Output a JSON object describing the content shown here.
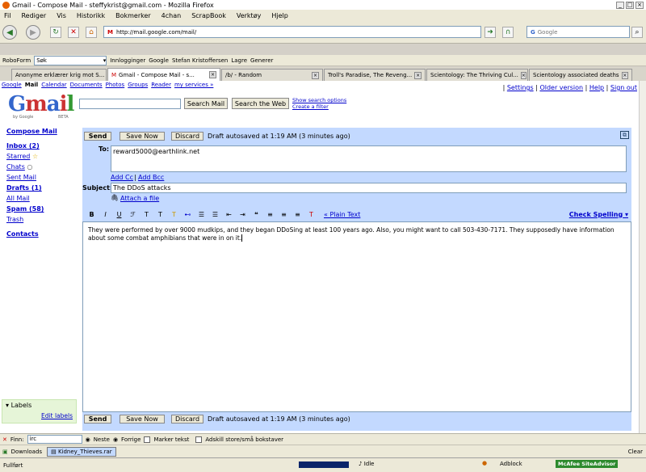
{
  "window": {
    "title": "Gmail - Compose Mail - steffykrist@gmail.com - Mozilla Firefox"
  },
  "menu": [
    "Fil",
    "Rediger",
    "Vis",
    "Historikk",
    "Bokmerker",
    "4chan",
    "ScrapBook",
    "Verktøy",
    "Hjelp"
  ],
  "address": {
    "url": "http://mail.google.com/mail/",
    "search_placeholder": "Google"
  },
  "bookmarks": {
    "roboform": "RoboForm",
    "search_value": "Søk",
    "items": [
      "Innlogginger",
      "Google",
      "Stefan Kristoffersen",
      "Lagre",
      "Generer"
    ]
  },
  "tabs": [
    {
      "label": "Anonyme erklærer krig mot S..."
    },
    {
      "label": "Gmail - Compose Mail - s..."
    },
    {
      "label": "/b/ - Random"
    },
    {
      "label": "Troll's Paradise, The Reveng..."
    },
    {
      "label": "Scientology: The Thriving Cul..."
    },
    {
      "label": "Scientology associated deaths"
    }
  ],
  "gbar": {
    "links": [
      "Google",
      "Mail",
      "Calendar",
      "Documents",
      "Photos",
      "Groups",
      "Reader",
      "my services »"
    ],
    "right": [
      "Settings",
      "Older version",
      "Help",
      "Sign out"
    ]
  },
  "logo": {
    "by": "by Google",
    "beta": "BETA"
  },
  "search": {
    "mail_btn": "Search Mail",
    "web_btn": "Search the Web",
    "options": "Show search options",
    "filter": "Create a filter"
  },
  "sidebar": {
    "compose": "Compose Mail",
    "inbox": "Inbox (2)",
    "starred": "Starred",
    "chats": "Chats",
    "sent": "Sent Mail",
    "drafts": "Drafts (1)",
    "all": "All Mail",
    "spam": "Spam (58)",
    "trash": "Trash",
    "contacts": "Contacts",
    "labels_title": "Labels",
    "edit_labels": "Edit labels"
  },
  "compose": {
    "send": "Send",
    "save": "Save Now",
    "discard": "Discard",
    "autosave": "Draft autosaved at 1:19 AM (3 minutes ago)",
    "to_label": "To:",
    "to_value": "reward5000@earthlink.net",
    "add_cc": "Add Cc",
    "add_bcc": "Add Bcc",
    "subject_label": "Subject:",
    "subject_value": "The DDoS attacks",
    "attach": "Attach a file",
    "plain_text": "« Plain Text",
    "spell": "Check Spelling",
    "body": "They were performed by over 9000 mudkips, and they began DDoSing at least 100 years ago. Also, you might want to call 503-430-7171. They supposedly have information about some combat amphibians that were in on it."
  },
  "findbar": {
    "label": "Finn:",
    "value": "irc",
    "next": "Neste",
    "prev": "Forrige",
    "highlight": "Marker tekst",
    "match_case": "Adskill store/små bokstaver"
  },
  "downloads": {
    "label": "Downloads",
    "file": "Kidney_Thieves.rar",
    "clear": "Clear"
  },
  "status": {
    "left": "Fullført",
    "idle": "Idle",
    "adblock": "Adblock",
    "mcafee": "McAfee SiteAdvisor"
  }
}
